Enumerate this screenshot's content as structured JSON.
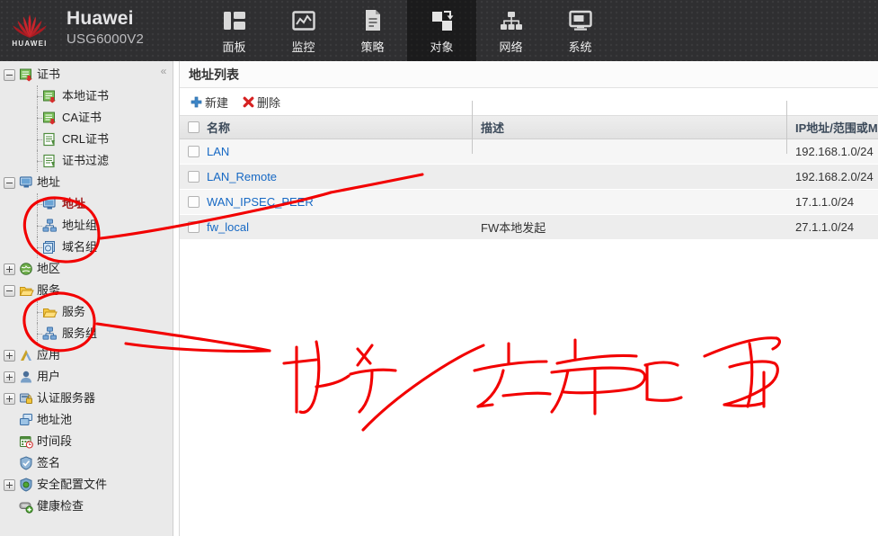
{
  "header": {
    "brand_name": "Huawei",
    "model": "USG6000V2",
    "logo_text": "HUAWEI",
    "nav": [
      {
        "label": "面板",
        "icon": "panel-icon",
        "active": false
      },
      {
        "label": "监控",
        "icon": "monitor-icon",
        "active": false
      },
      {
        "label": "策略",
        "icon": "policy-icon",
        "active": false
      },
      {
        "label": "对象",
        "icon": "object-icon",
        "active": true
      },
      {
        "label": "网络",
        "icon": "network-icon",
        "active": false
      },
      {
        "label": "系统",
        "icon": "system-icon",
        "active": false
      }
    ]
  },
  "sidebar": {
    "collapse_glyph": "«",
    "items": [
      {
        "label": "证书",
        "level": 0,
        "toggle": "minus",
        "icon": "certificate-icon",
        "selected": false
      },
      {
        "label": "本地证书",
        "level": 1,
        "toggle": "none",
        "icon": "local-cert-icon",
        "selected": false
      },
      {
        "label": "CA证书",
        "level": 1,
        "toggle": "none",
        "icon": "ca-cert-icon",
        "selected": false
      },
      {
        "label": "CRL证书",
        "level": 1,
        "toggle": "none",
        "icon": "crl-cert-icon",
        "selected": false
      },
      {
        "label": "证书过滤",
        "level": 1,
        "toggle": "none",
        "icon": "cert-filter-icon",
        "selected": false
      },
      {
        "label": "地址",
        "level": 0,
        "toggle": "minus",
        "icon": "address-icon",
        "selected": false
      },
      {
        "label": "地址",
        "level": 1,
        "toggle": "none",
        "icon": "address-icon",
        "selected": true
      },
      {
        "label": "地址组",
        "level": 1,
        "toggle": "none",
        "icon": "address-group-icon",
        "selected": false
      },
      {
        "label": "域名组",
        "level": 1,
        "toggle": "none",
        "icon": "domain-group-icon",
        "selected": false
      },
      {
        "label": "地区",
        "level": 0,
        "toggle": "plus",
        "icon": "region-icon",
        "selected": false
      },
      {
        "label": "服务",
        "level": 0,
        "toggle": "minus",
        "icon": "service-icon",
        "selected": false
      },
      {
        "label": "服务",
        "level": 1,
        "toggle": "none",
        "icon": "service-icon",
        "selected": false
      },
      {
        "label": "服务组",
        "level": 1,
        "toggle": "none",
        "icon": "service-group-icon",
        "selected": false
      },
      {
        "label": "应用",
        "level": 0,
        "toggle": "plus",
        "icon": "application-icon",
        "selected": false
      },
      {
        "label": "用户",
        "level": 0,
        "toggle": "plus",
        "icon": "user-icon",
        "selected": false
      },
      {
        "label": "认证服务器",
        "level": 0,
        "toggle": "plus",
        "icon": "auth-server-icon",
        "selected": false
      },
      {
        "label": "地址池",
        "level": 0,
        "toggle": "none",
        "icon": "address-pool-icon",
        "selected": false
      },
      {
        "label": "时间段",
        "level": 0,
        "toggle": "none",
        "icon": "time-range-icon",
        "selected": false
      },
      {
        "label": "签名",
        "level": 0,
        "toggle": "none",
        "icon": "signature-icon",
        "selected": false
      },
      {
        "label": "安全配置文件",
        "level": 0,
        "toggle": "plus",
        "icon": "security-profile-icon",
        "selected": false
      },
      {
        "label": "健康检查",
        "level": 0,
        "toggle": "none",
        "icon": "health-check-icon",
        "selected": false
      }
    ]
  },
  "content": {
    "panel_title": "地址列表",
    "toolbar": {
      "new_label": "新建",
      "delete_label": "删除"
    },
    "table": {
      "columns": [
        "名称",
        "描述",
        "IP地址/范围或MA"
      ],
      "rows": [
        {
          "name": "LAN",
          "desc": "",
          "ip": "192.168.1.0/24"
        },
        {
          "name": "LAN_Remote",
          "desc": "",
          "ip": "192.168.2.0/24"
        },
        {
          "name": "WAN_IPSEC_PEER",
          "desc": "",
          "ip": "17.1.1.0/24"
        },
        {
          "name": "fw_local",
          "desc": "FW本地发起",
          "ip": "27.1.1.0/24"
        }
      ]
    }
  },
  "annotation": {
    "color": "#f20000",
    "note": "handwritten red ink markup: two ellipses around sidebar groups, arrows to content area, and large handwritten Chinese characters"
  },
  "colors": {
    "header_bg": "#2f2f31",
    "sidebar_bg": "#eaeaea",
    "link": "#1769c4",
    "selected_text": "#9e1b1b",
    "row_odd": "#f6f6f6",
    "row_even": "#ededed"
  }
}
